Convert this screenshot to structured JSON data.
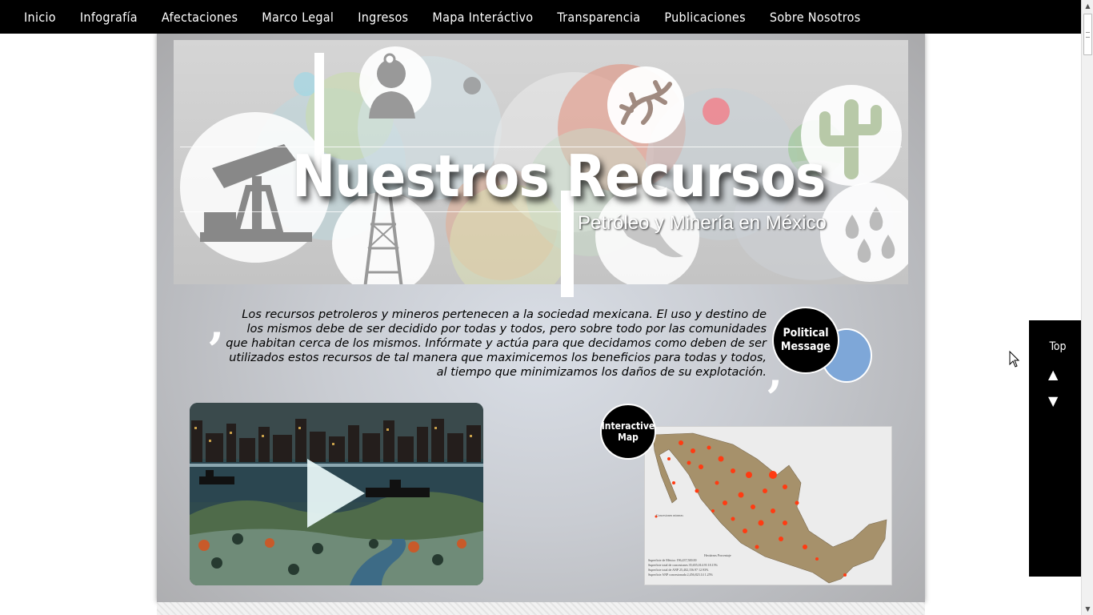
{
  "nav": {
    "items": [
      "Inicio",
      "Infografía",
      "Afectaciones",
      "Marco Legal",
      "Ingresos",
      "Mapa Interáctivo",
      "Transparencia",
      "Publicaciones",
      "Sobre Nosotros"
    ]
  },
  "banner": {
    "title": "Nuestros Recursos",
    "subtitle": "Petróleo y Minería en México"
  },
  "quote": {
    "text": "Los recursos petroleros y mineros pertenecen a la sociedad mexicana. El uso y destino de los mismos debe de ser decidido por todas y todos, pero sobre todo por las comunidades que habitan cerca de los mismos. Infórmate y actúa para que decidamos como deben de ser utilizados estos recursos de tal manera que maximicemos los beneficios para todas y todos, al tiempo que minimizamos los daños de su explotación."
  },
  "badges": {
    "political": "Political Message",
    "map": "Interactive Map"
  },
  "map": {
    "legend": "Concesiones mineras",
    "table_header": [
      "Hectáreas",
      "Porcentaje"
    ],
    "table_rows": [
      [
        "Superficie de México",
        "196,437,500.00",
        ""
      ],
      [
        "Superficie total de concesiones",
        "35,655,014.93",
        "18.15%"
      ],
      [
        "Superficie total de ANP",
        "25,402,156.97",
        "12.93%"
      ],
      [
        "Superficie ANP concesionada",
        "2,456,823.14",
        "1.25%"
      ]
    ]
  },
  "sidepanel": {
    "top_label": "Top",
    "up_arrow": "▲",
    "down_arrow": "▼"
  },
  "colors": {
    "nav_bg": "#000000",
    "map_land": "#a6916b",
    "map_dots": "#ff3b12",
    "badge_blue": "#7ea7d8"
  }
}
